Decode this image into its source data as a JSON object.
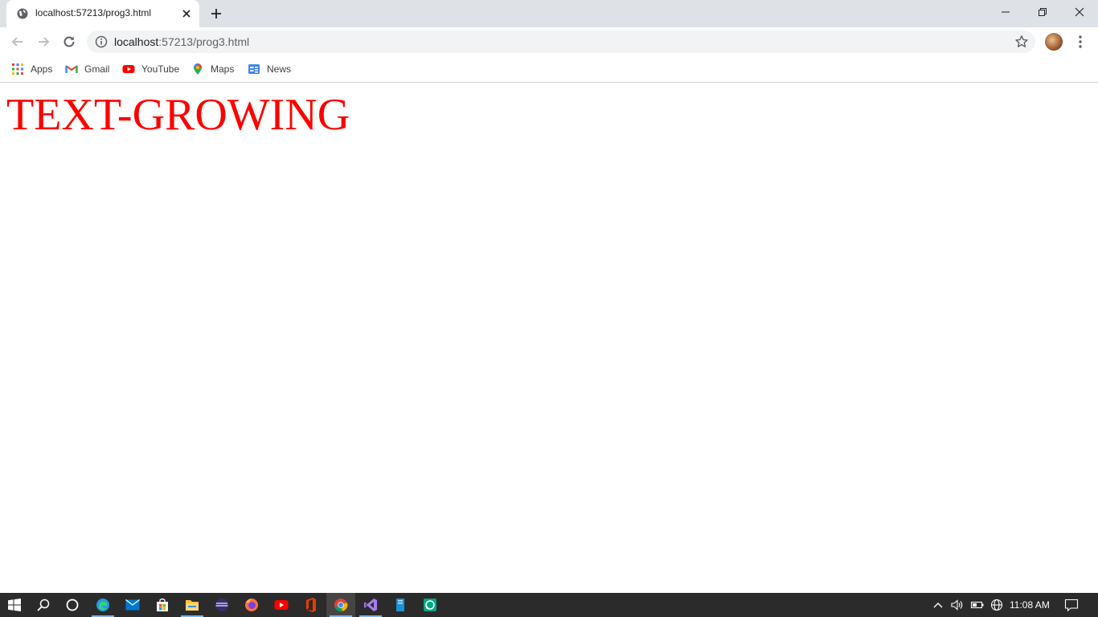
{
  "browser": {
    "tab_title": "localhost:57213/prog3.html",
    "url_host": "localhost",
    "url_rest": ":57213/prog3.html"
  },
  "bookmarks": {
    "items": [
      {
        "label": "Apps",
        "icon": "apps-grid-icon"
      },
      {
        "label": "Gmail",
        "icon": "gmail-icon"
      },
      {
        "label": "YouTube",
        "icon": "youtube-icon"
      },
      {
        "label": "Maps",
        "icon": "maps-icon"
      },
      {
        "label": "News",
        "icon": "news-icon"
      }
    ]
  },
  "page": {
    "heading": "TEXT-GROWING",
    "heading_color": "#ff0000"
  },
  "taskbar": {
    "clock": "11:08 AM",
    "pinned_icons": [
      "windows-start-icon",
      "search-icon",
      "cortana-icon",
      "edge-icon",
      "mail-icon",
      "store-icon",
      "file-explorer-icon",
      "app-icon",
      "firefox-icon",
      "youtube-icon",
      "office-icon",
      "chrome-icon",
      "visual-studio-icon",
      "app-icon",
      "whatsapp-icon"
    ]
  }
}
